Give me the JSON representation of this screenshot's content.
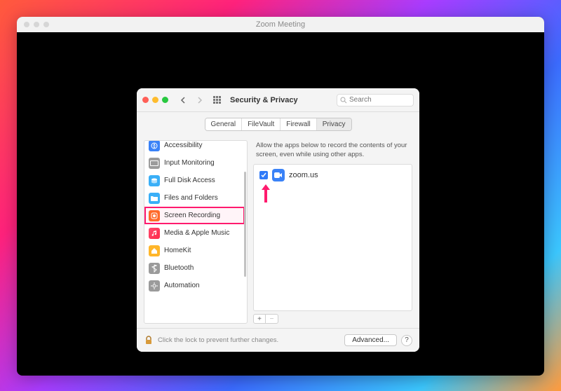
{
  "zoom": {
    "title": "Zoom Meeting"
  },
  "pref": {
    "title": "Security & Privacy",
    "search_placeholder": "Search",
    "tabs": {
      "t0": "General",
      "t1": "FileVault",
      "t2": "Firewall",
      "t3": "Privacy"
    },
    "sidebar": {
      "i0": "Accessibility",
      "i1": "Input Monitoring",
      "i2": "Full Disk Access",
      "i3": "Files and Folders",
      "i4": "Screen Recording",
      "i5": "Media & Apple Music",
      "i6": "HomeKit",
      "i7": "Bluetooth",
      "i8": "Automation"
    },
    "intro": "Allow the apps below to record the contents of your screen, even while using other apps.",
    "apps": {
      "a0": "zoom.us"
    },
    "footer": "Click the lock to prevent further changes.",
    "advanced": "Advanced...",
    "help": "?"
  }
}
